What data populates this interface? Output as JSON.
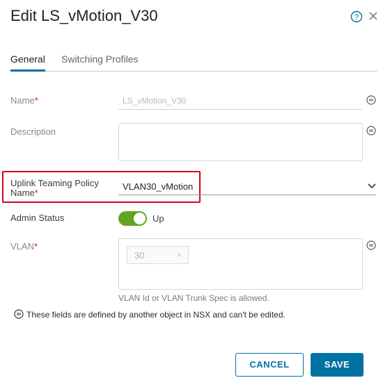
{
  "dialog": {
    "title": "Edit LS_vMotion_V30"
  },
  "tabs": [
    {
      "label": "General",
      "active": true
    },
    {
      "label": "Switching Profiles",
      "active": false
    }
  ],
  "form": {
    "name_label": "Name",
    "name_value": "LS_vMotion_V30",
    "description_label": "Description",
    "description_value": "",
    "uplink_label_line1": "Uplink Teaming Policy",
    "uplink_label_line2": "Name",
    "uplink_value": "VLAN30_vMotion",
    "admin_status_label": "Admin Status",
    "admin_status_value": "Up",
    "admin_status_on": true,
    "vlan_label": "VLAN",
    "vlan_chip": "30",
    "vlan_chip_remove": "×",
    "vlan_helper": "VLAN Id or VLAN Trunk Spec is allowed.",
    "required_marker": "*"
  },
  "note": "These fields are defined by another object in NSX and can't be edited.",
  "buttons": {
    "cancel": "CANCEL",
    "save": "SAVE"
  },
  "colors": {
    "accent": "#0072a3",
    "toggle_on": "#62a420",
    "required": "#c92100",
    "highlight_box": "#d0021b"
  },
  "icons": {
    "help": "help-circle-icon",
    "close": "close-icon",
    "read_only": "minus-circle-icon",
    "dropdown": "chevron-down-icon"
  }
}
